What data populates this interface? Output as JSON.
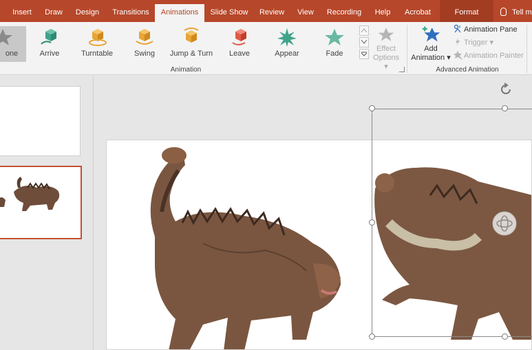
{
  "tabs": [
    {
      "label": "Insert"
    },
    {
      "label": "Draw"
    },
    {
      "label": "Design"
    },
    {
      "label": "Transitions"
    },
    {
      "label": "Animations",
      "active": true
    },
    {
      "label": "Slide Show"
    },
    {
      "label": "Review"
    },
    {
      "label": "View"
    },
    {
      "label": "Recording"
    },
    {
      "label": "Help"
    },
    {
      "label": "Acrobat"
    },
    {
      "label": "Format"
    }
  ],
  "tell_me": "Tell m",
  "animation_gallery": {
    "items": [
      {
        "label": "one",
        "icon": "star-icon",
        "selected": true
      },
      {
        "label": "Arrive",
        "icon": "arrive-icon"
      },
      {
        "label": "Turntable",
        "icon": "turntable-icon"
      },
      {
        "label": "Swing",
        "icon": "swing-icon"
      },
      {
        "label": "Jump & Turn",
        "icon": "jump-turn-icon"
      },
      {
        "label": "Leave",
        "icon": "leave-icon"
      },
      {
        "label": "Appear",
        "icon": "appear-icon"
      },
      {
        "label": "Fade",
        "icon": "fade-icon"
      }
    ],
    "group_label": "Animation"
  },
  "effect_options": {
    "line1": "Effect",
    "line2": "Options ▾"
  },
  "advanced": {
    "add_animation_line1": "Add",
    "add_animation_line2": "Animation ▾",
    "animation_pane": "Animation Pane",
    "trigger": "Trigger ▾",
    "animation_painter": "Animation Painter",
    "group_label": "Advanced Animation"
  },
  "colors": {
    "brand": "#b7472a",
    "ribbon_bg": "#f3f3f3",
    "accent_selected": "#c4502f"
  }
}
